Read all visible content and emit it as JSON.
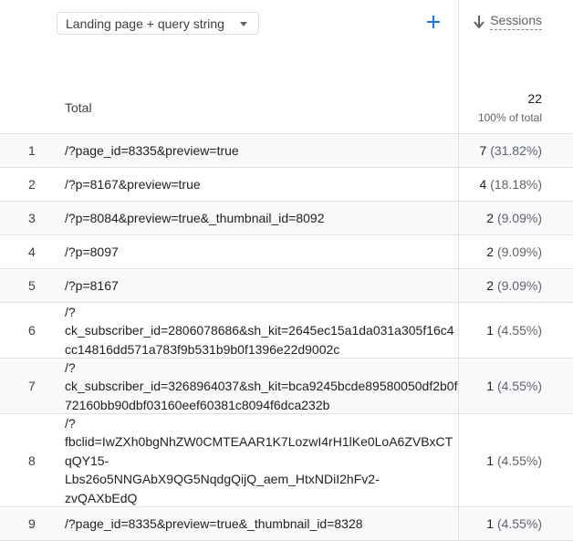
{
  "dimension_selector": {
    "label": "Landing page + query string"
  },
  "add_dimension": {
    "icon": "plus-icon"
  },
  "metric": {
    "label": "Sessions",
    "sort": "descending",
    "sort_icon": "arrow-down-icon"
  },
  "totals": {
    "label": "Total",
    "value": "22",
    "sub": "100% of total"
  },
  "colors": {
    "accent": "#1a73e8",
    "border": "#e0e0e0",
    "alt_row": "#f8f9fa"
  },
  "rows": [
    {
      "index": "1",
      "dimension": "/?page_id=8335&preview=true",
      "value": "7",
      "pct": "(31.82%)"
    },
    {
      "index": "2",
      "dimension": "/?p=8167&preview=true",
      "value": "4",
      "pct": "(18.18%)"
    },
    {
      "index": "3",
      "dimension": "/?p=8084&preview=true&_thumbnail_id=8092",
      "value": "2",
      "pct": "(9.09%)"
    },
    {
      "index": "4",
      "dimension": "/?p=8097",
      "value": "2",
      "pct": "(9.09%)"
    },
    {
      "index": "5",
      "dimension": "/?p=8167",
      "value": "2",
      "pct": "(9.09%)"
    },
    {
      "index": "6",
      "dimension": "/?\nck_subscriber_id=2806078686&sh_kit=2645ec15a1da031a305f16c4cc14816dd571a783f9b531b9b0f1396e22d9002c",
      "value": "1",
      "pct": "(4.55%)"
    },
    {
      "index": "7",
      "dimension": "/?\nck_subscriber_id=3268964037&sh_kit=bca9245bcde89580050df2b0f72160bb90dbf03160eef60381c8094f6dca232b",
      "value": "1",
      "pct": "(4.55%)"
    },
    {
      "index": "8",
      "dimension": "/?\nfbclid=IwZXh0bgNhZW0CMTEAAR1K7LozwI4rH1lKe0LoA6ZVBxCTqQY15-\nLbs26o5NNGAbX9QG5NqdgQijQ_aem_HtxNDiI2hFv2-\nzvQAXbEdQ",
      "value": "1",
      "pct": "(4.55%)"
    },
    {
      "index": "9",
      "dimension": "/?page_id=8335&preview=true&_thumbnail_id=8328",
      "value": "1",
      "pct": "(4.55%)"
    }
  ]
}
